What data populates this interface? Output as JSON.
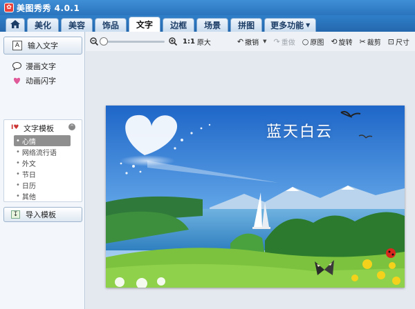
{
  "app": {
    "title": "美图秀秀 4.0.1",
    "logo_icon": "meitu-logo-icon"
  },
  "tabs": [
    {
      "label": "",
      "icon": "home-icon"
    },
    {
      "label": "美化"
    },
    {
      "label": "美容"
    },
    {
      "label": "饰品"
    },
    {
      "label": "文字",
      "active": true
    },
    {
      "label": "边框"
    },
    {
      "label": "场景"
    },
    {
      "label": "拼图"
    },
    {
      "label": "更多功能"
    }
  ],
  "sidebar": {
    "input_text_label": "输入文字",
    "comic_text_label": "漫画文字",
    "animated_text_label": "动画闪字",
    "template_header": "文字模板",
    "templates": [
      "心情",
      "网络流行语",
      "外文",
      "节日",
      "日历",
      "其他"
    ],
    "selected_template": "心情",
    "import_label": "导入模板"
  },
  "toolbar": {
    "ratio_label": "1:1",
    "original_size_label": "原大",
    "undo_label": "撤销",
    "redo_label": "重做",
    "original_image_label": "原图",
    "rotate_label": "旋转",
    "crop_label": "裁剪",
    "size_label": "尺寸",
    "zoom_level": 0
  },
  "canvas": {
    "caption": "蓝天白云"
  },
  "colors": {
    "titlebar": "#2f7fc9",
    "active_tab": "#ffffff",
    "accent_red": "#e8423b"
  }
}
